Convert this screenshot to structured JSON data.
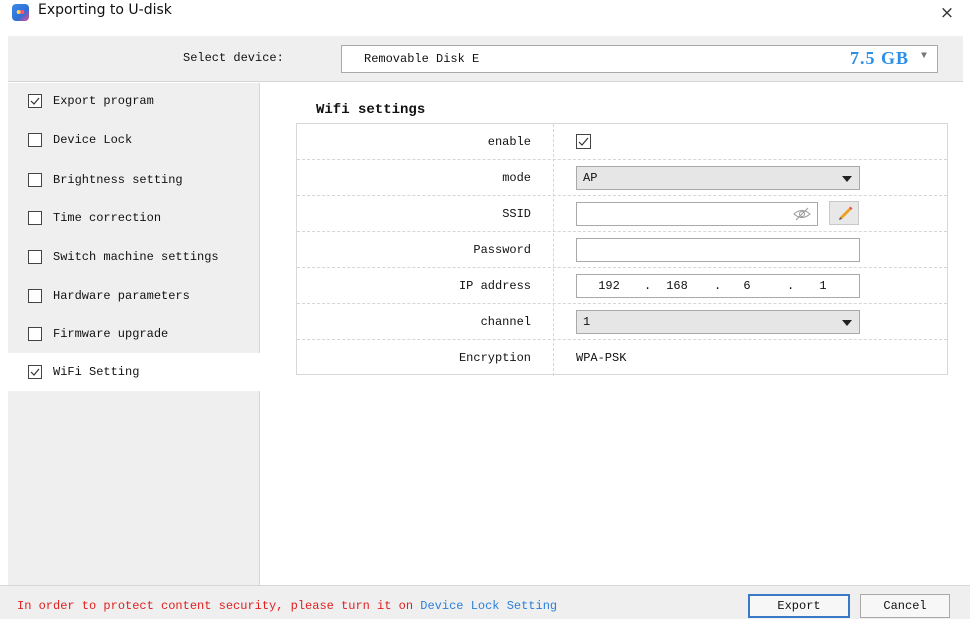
{
  "window": {
    "title": "Exporting to U-disk",
    "close_glyph": "×",
    "icon": "app-icon"
  },
  "device": {
    "label": "Select device:",
    "name": "Removable Disk E",
    "size": "7.5 GB",
    "arrow_glyph": "▼"
  },
  "sidebar": {
    "items": [
      {
        "label": "Export program",
        "checked": true,
        "active": false
      },
      {
        "label": "Device Lock",
        "checked": false,
        "active": false
      },
      {
        "label": "Brightness setting",
        "checked": false,
        "active": false
      },
      {
        "label": "Time correction",
        "checked": false,
        "active": false
      },
      {
        "label": "Switch machine settings",
        "checked": false,
        "active": false
      },
      {
        "label": "Hardware parameters",
        "checked": false,
        "active": false
      },
      {
        "label": "Firmware upgrade",
        "checked": false,
        "active": false
      },
      {
        "label": "WiFi Setting",
        "checked": true,
        "active": true
      }
    ]
  },
  "wifi": {
    "title": "Wifi settings",
    "enable": {
      "label": "enable",
      "checked": true
    },
    "mode": {
      "label": "mode",
      "value": "AP"
    },
    "ssid": {
      "label": "SSID",
      "value": "",
      "eye_icon": "eye-hidden-icon",
      "edit_icon": "pencil-icon"
    },
    "password": {
      "label": "Password",
      "value": ""
    },
    "ip": {
      "label": "IP address",
      "octets": [
        "192",
        "168",
        "6",
        "1"
      ],
      "separator": "."
    },
    "channel": {
      "label": "channel",
      "value": "1"
    },
    "encryption": {
      "label": "Encryption",
      "value": "WPA-PSK"
    }
  },
  "footer": {
    "message": "In order to protect content security, please turn it on",
    "link": "Device Lock Setting",
    "export_label": "Export",
    "cancel_label": "Cancel"
  },
  "colors": {
    "accent": "#2a8fe8",
    "warning": "#e02020",
    "link": "#2a7fdc",
    "panel": "#efefef"
  }
}
